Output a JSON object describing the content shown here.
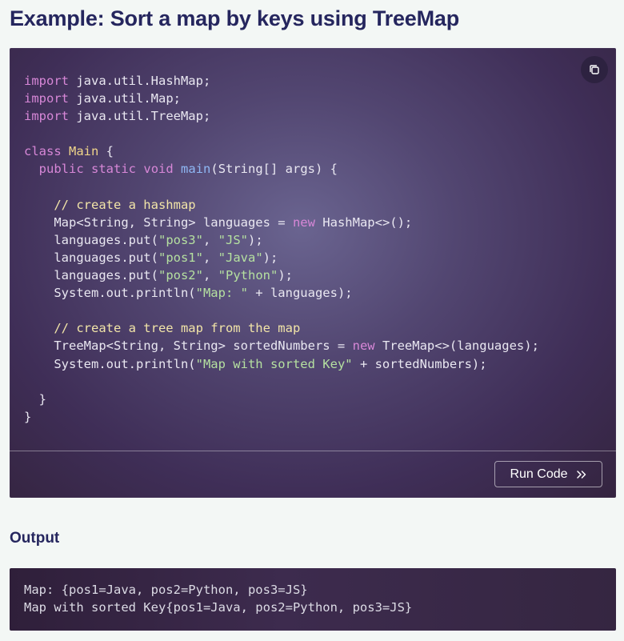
{
  "title": "Example: Sort a map by keys using TreeMap",
  "code": {
    "lines": [
      [
        {
          "t": "import",
          "c": "kw"
        },
        {
          "t": " java.util.HashMap;"
        }
      ],
      [
        {
          "t": "import",
          "c": "kw"
        },
        {
          "t": " java.util.Map;"
        }
      ],
      [
        {
          "t": "import",
          "c": "kw"
        },
        {
          "t": " java.util.TreeMap;"
        }
      ],
      [],
      [
        {
          "t": "class",
          "c": "kw"
        },
        {
          "t": " "
        },
        {
          "t": "Main",
          "c": "cls"
        },
        {
          "t": " {"
        }
      ],
      [
        {
          "t": "  "
        },
        {
          "t": "public",
          "c": "kw"
        },
        {
          "t": " "
        },
        {
          "t": "static",
          "c": "kw"
        },
        {
          "t": " "
        },
        {
          "t": "void",
          "c": "kw"
        },
        {
          "t": " "
        },
        {
          "t": "main",
          "c": "fn"
        },
        {
          "t": "(String[] args) {"
        }
      ],
      [],
      [
        {
          "t": "    "
        },
        {
          "t": "// create a hashmap",
          "c": "cmt"
        }
      ],
      [
        {
          "t": "    Map<String, String> languages = "
        },
        {
          "t": "new",
          "c": "kw"
        },
        {
          "t": " HashMap<>();"
        }
      ],
      [
        {
          "t": "    languages.put("
        },
        {
          "t": "\"pos3\"",
          "c": "str"
        },
        {
          "t": ", "
        },
        {
          "t": "\"JS\"",
          "c": "str"
        },
        {
          "t": ");"
        }
      ],
      [
        {
          "t": "    languages.put("
        },
        {
          "t": "\"pos1\"",
          "c": "str"
        },
        {
          "t": ", "
        },
        {
          "t": "\"Java\"",
          "c": "str"
        },
        {
          "t": ");"
        }
      ],
      [
        {
          "t": "    languages.put("
        },
        {
          "t": "\"pos2\"",
          "c": "str"
        },
        {
          "t": ", "
        },
        {
          "t": "\"Python\"",
          "c": "str"
        },
        {
          "t": ");"
        }
      ],
      [
        {
          "t": "    System.out.println("
        },
        {
          "t": "\"Map: \"",
          "c": "str"
        },
        {
          "t": " + languages);"
        }
      ],
      [],
      [
        {
          "t": "    "
        },
        {
          "t": "// create a tree map from the map",
          "c": "cmt"
        }
      ],
      [
        {
          "t": "    TreeMap<String, String> sortedNumbers = "
        },
        {
          "t": "new",
          "c": "kw"
        },
        {
          "t": " TreeMap<>(languages);"
        }
      ],
      [
        {
          "t": "    System.out.println("
        },
        {
          "t": "\"Map with sorted Key\"",
          "c": "str"
        },
        {
          "t": " + sortedNumbers);"
        }
      ],
      [],
      [
        {
          "t": "  }"
        }
      ],
      [
        {
          "t": "}"
        }
      ]
    ]
  },
  "copy_icon": "copy-icon",
  "run_button": {
    "label": "Run Code",
    "icon": "double-chevron-right-icon"
  },
  "output": {
    "heading": "Output",
    "lines": [
      "Map: {pos1=Java, pos2=Python, pos3=JS}",
      "Map with sorted Key{pos1=Java, pos2=Python, pos3=JS}"
    ]
  },
  "colors": {
    "title": "#25265e",
    "keyword": "#d787d7",
    "string": "#b5e0a0",
    "comment": "#f2e5a8",
    "function": "#8fb8f5",
    "class_name": "#f0d58a"
  }
}
